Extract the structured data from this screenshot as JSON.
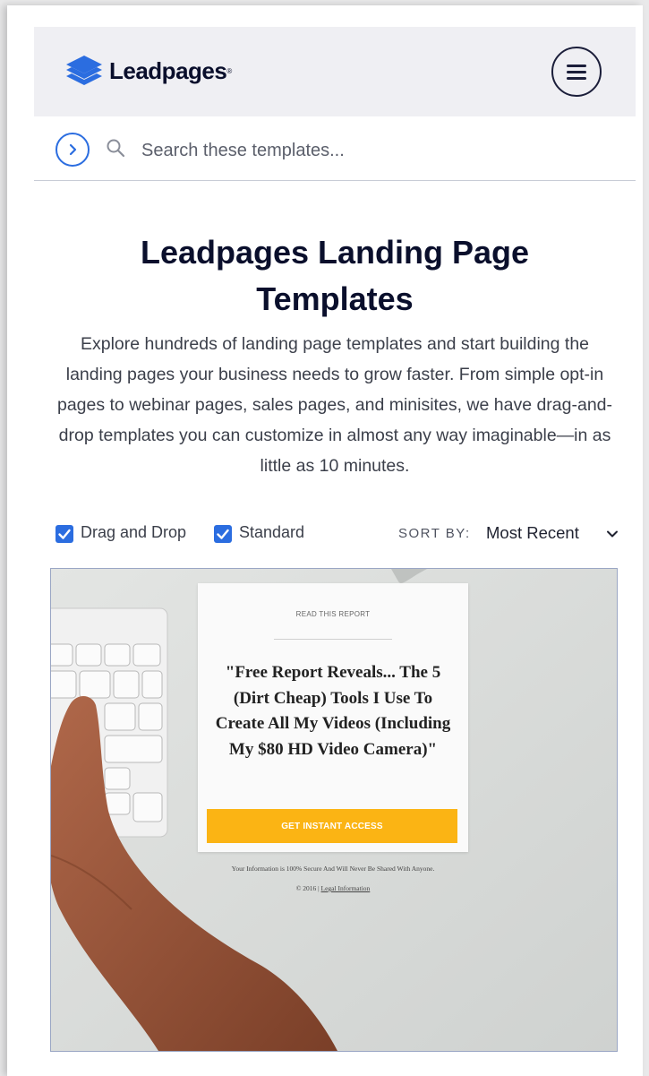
{
  "header": {
    "brand": "Leadpages",
    "brand_reg": "®",
    "menu_icon": "hamburger-icon"
  },
  "search": {
    "placeholder": "Search these templates...",
    "value": "",
    "expand_icon": "chevron-right-circle-icon",
    "search_icon": "search-icon"
  },
  "intro": {
    "title": "Leadpages Landing Page Templates",
    "description": "Explore hundreds of landing page templates and start building the landing pages your business needs to grow faster. From simple opt-in pages to webinar pages, sales pages, and minisites, we have drag-and-drop templates you can customize in almost any way imaginable—in as little as 10 minutes."
  },
  "filters": {
    "drag_and_drop": {
      "label": "Drag and Drop",
      "checked": true
    },
    "standard": {
      "label": "Standard",
      "checked": true
    },
    "sort_label": "SORT BY:",
    "sort_value": "Most Recent"
  },
  "template_card": {
    "eyebrow": "READ THIS REPORT",
    "headline": "\"Free Report Reveals... The 5 (Dirt Cheap) Tools I Use To Create All My Videos (Including My $80 HD Video Camera)\"",
    "cta_label": "GET INSTANT ACCESS",
    "secure_note": "Your Information is 100% Secure And Will Never Be Shared With Anyone.",
    "copyright": "© 2016 |",
    "legal_link": "Legal Information"
  },
  "colors": {
    "brand_navy": "#0a0f2c",
    "accent_blue": "#2b6de0",
    "cta_yellow": "#fbb414",
    "header_bg": "#efeff3"
  }
}
